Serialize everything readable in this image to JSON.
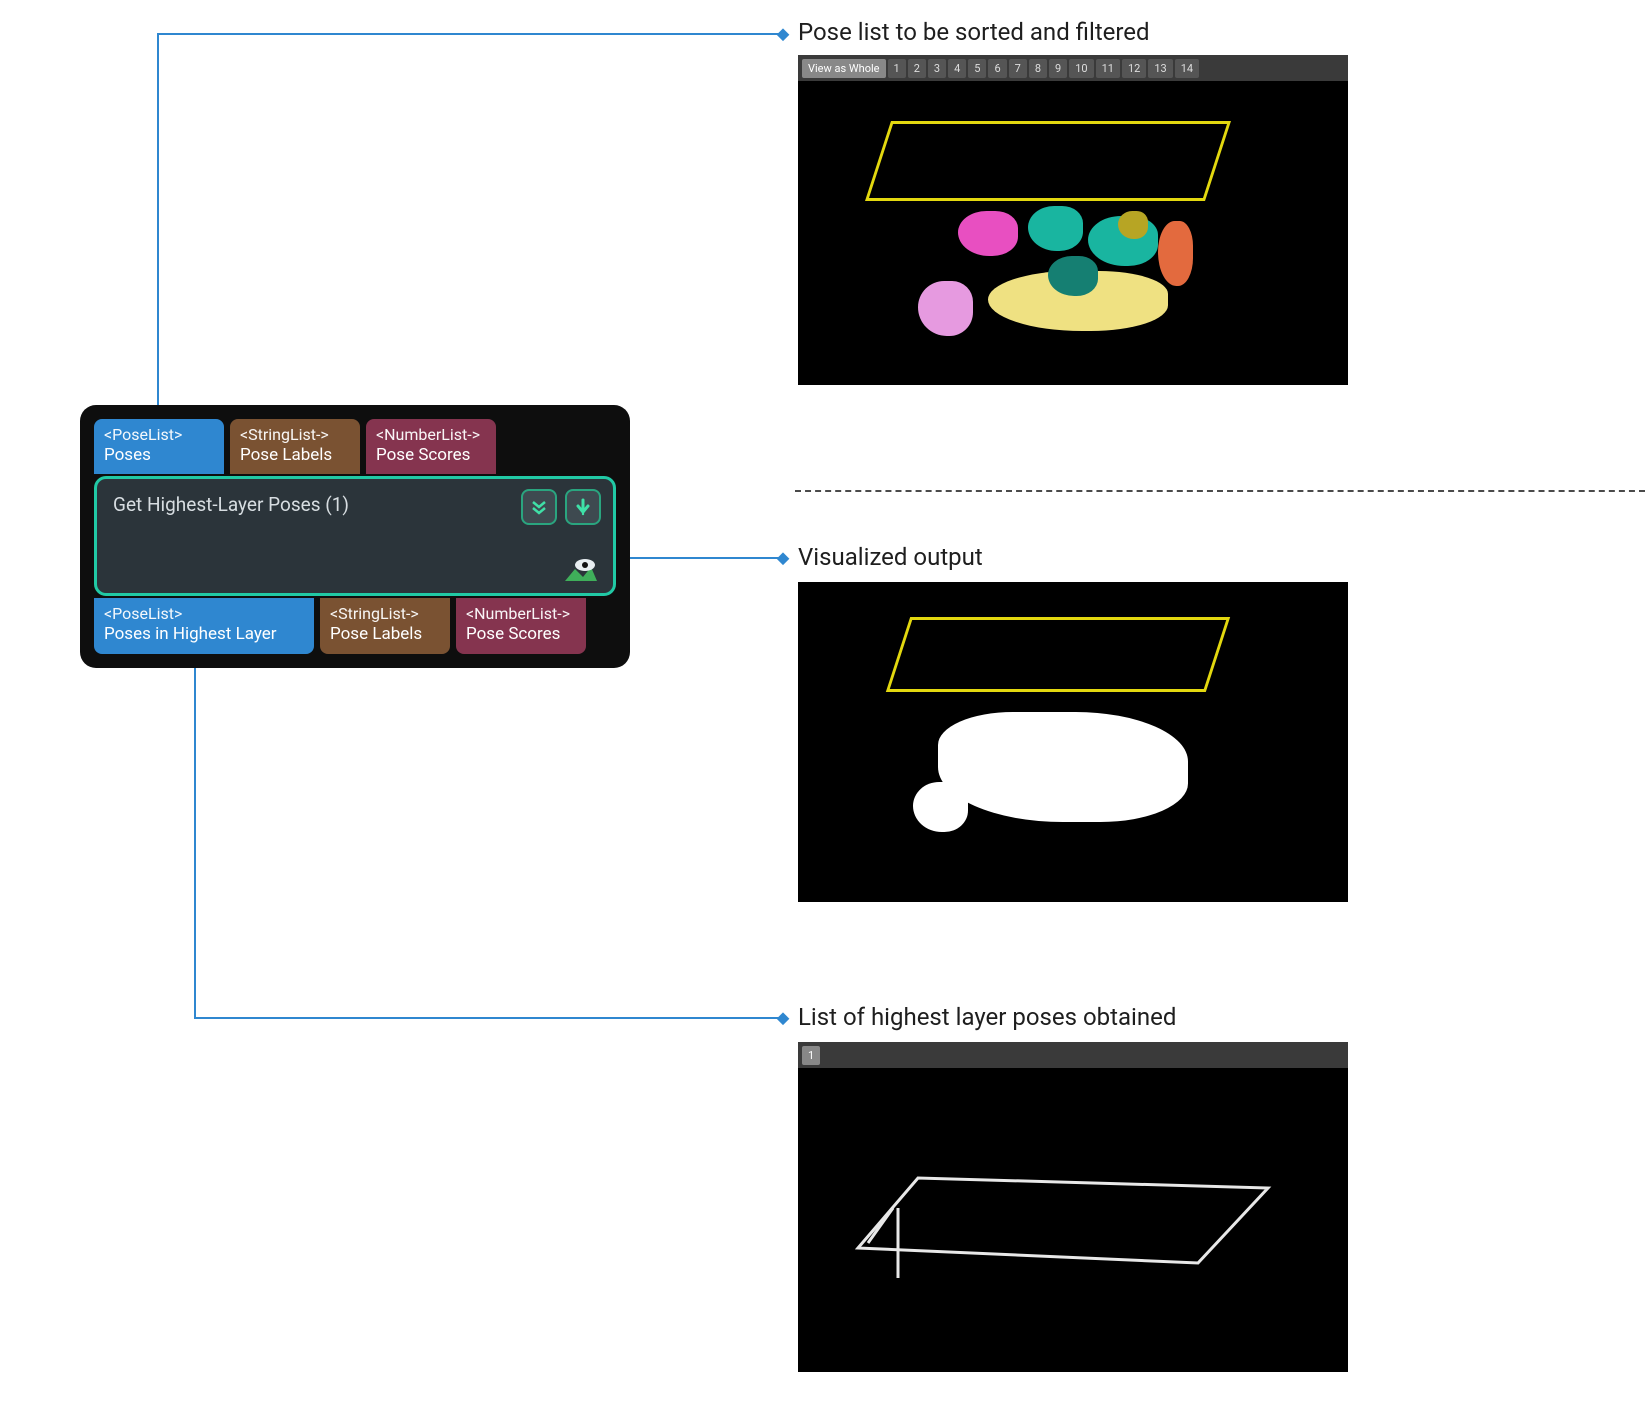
{
  "callouts": {
    "input": "Pose list to be sorted and filtered",
    "vis": "Visualized output",
    "output": "List of highest layer poses obtained"
  },
  "node": {
    "title": "Get Highest-Layer Poses (1)",
    "inputs": [
      {
        "type": "<PoseList>",
        "name": "Poses",
        "color": "posecol"
      },
      {
        "type": "<StringList->",
        "name": "Pose Labels",
        "color": "strcol"
      },
      {
        "type": "<NumberList->",
        "name": "Pose Scores",
        "color": "numcol"
      }
    ],
    "outputs": [
      {
        "type": "<PoseList>",
        "name": "Poses in Highest Layer",
        "color": "posecol"
      },
      {
        "type": "<StringList->",
        "name": "Pose Labels",
        "color": "strcol"
      },
      {
        "type": "<NumberList->",
        "name": "Pose Scores",
        "color": "numcol"
      }
    ],
    "body_icons": {
      "expand": "expand-down-icon",
      "run": "run-arrow-icon",
      "visualize": "visualize-eye-icon"
    }
  },
  "viewers": {
    "top": {
      "tabs_first": "View as Whole",
      "tabs_nums": [
        "1",
        "2",
        "3",
        "4",
        "5",
        "6",
        "7",
        "8",
        "9",
        "10",
        "11",
        "12",
        "13",
        "14"
      ]
    },
    "bottom": {
      "tabs_nums": [
        "1"
      ]
    }
  },
  "colors": {
    "connector": "#2f87d0",
    "node_border": "#21c9a5",
    "pose": "#2f87d0",
    "string": "#7a5232",
    "number": "#85344f"
  }
}
